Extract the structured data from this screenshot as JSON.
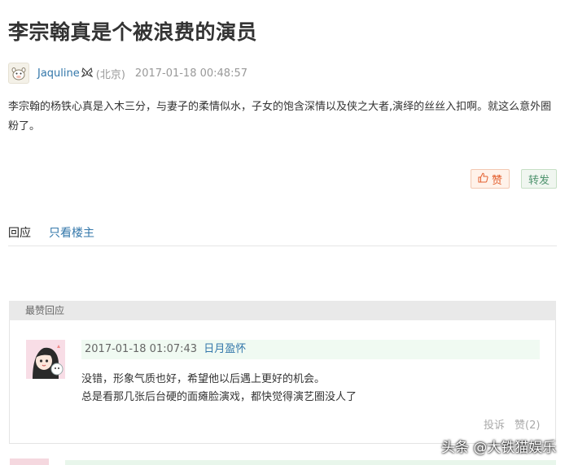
{
  "post": {
    "title": "李宗翰真是个被浪费的演员",
    "author": "Jaquline",
    "author_badge_icon": "butterfly-icon",
    "location": "(北京)",
    "timestamp": "2017-01-18 00:48:57",
    "body": "李宗翰的杨铁心真是入木三分，与妻子的柔情似水，子女的饱含深情以及侠之大者,演绎的丝丝入扣啊。就这么意外圈粉了。"
  },
  "actions": {
    "like_label": "赞",
    "share_label": "转发",
    "like_icon": "thumbs-up-icon"
  },
  "tabs": {
    "reply_label": "回应",
    "op_only_label": "只看楼主"
  },
  "hot_replies": {
    "header": "最赞回应",
    "items": [
      {
        "timestamp": "2017-01-18 01:07:43",
        "user": "日月盈怀",
        "line1": "没错，形象气质也好，希望他以后遇上更好的机会。",
        "line2": "总是看那几张后台硬的面瘫脸演戏，都快觉得演艺圈没人了",
        "report_label": "投诉",
        "like_label": "赞(2)"
      }
    ]
  },
  "watermark": "头条 @大铁猫娱乐",
  "colors": {
    "link": "#3377aa",
    "like_accent": "#e35f2e",
    "share_accent": "#4f946e"
  }
}
